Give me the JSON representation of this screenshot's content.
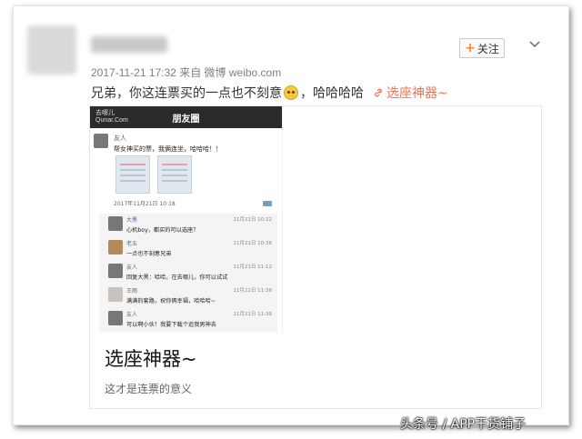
{
  "post": {
    "meta": "2017-11-21 17:32 来自 微博 weibo.com",
    "follow_label": "关注",
    "text_before": "兄弟，你这连票买的一点也不刻意",
    "text_after": "，哈哈哈哈",
    "link_label": "选座神器~"
  },
  "card": {
    "title": "选座神器~",
    "subtitle": "这才是连票的意义",
    "screenshot": {
      "logo_line1": "去哪儿",
      "logo_line2": "Qunar.Com",
      "title": "朋友圈",
      "post_name": "友人",
      "post_text": "帮女神买的票，我俩连坐，哈哈哈！！",
      "post_date": "2017年11月21日 10:18",
      "comments": [
        {
          "name": "大黑",
          "time": "11月21日 10:22",
          "text": "心机boy，都买的可以选座？"
        },
        {
          "name": "老五",
          "time": "11月21日 10:36",
          "text": "一点也不刻意兄弟"
        },
        {
          "name": "友人",
          "time": "11月21日 11:12",
          "text": "回复大黑：哈哈，在去哪儿，你可以试试"
        },
        {
          "name": "王雨",
          "time": "11月21日 11:36",
          "text": "满满的套路，祝你俩幸福，哈哈哈~"
        },
        {
          "name": "友人",
          "time": "11月21日 11:39",
          "text": "可以啊小伙！我要下载个追我男神去"
        }
      ]
    }
  },
  "watermark": "头条号 / APP干货铺子",
  "colors": {
    "accent": "#eb7350",
    "follow_plus": "#f28c28",
    "dark_bar": "#2b2b2b"
  }
}
